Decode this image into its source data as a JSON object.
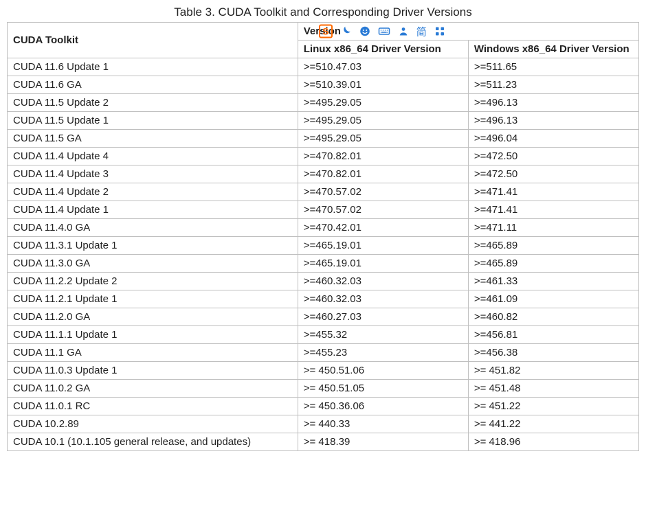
{
  "caption": "Table 3. CUDA Toolkit and Corresponding Driver Versions",
  "headers": {
    "cuda": "CUDA Toolkit",
    "tcdv_suffix": "Version",
    "linux": "Linux x86_64 Driver Version",
    "windows": "Windows x86_64 Driver Version"
  },
  "ime": {
    "logo_letter": "S",
    "simplified_label": "简"
  },
  "chart_data": {
    "type": "table",
    "title": "Table 3. CUDA Toolkit and Corresponding Driver Versions",
    "columns": [
      "CUDA Toolkit",
      "Linux x86_64 Driver Version",
      "Windows x86_64 Driver Version"
    ],
    "rows": [
      {
        "cuda": "CUDA 11.6 Update 1",
        "linux": ">=510.47.03",
        "windows": ">=511.65"
      },
      {
        "cuda": "CUDA 11.6 GA",
        "linux": ">=510.39.01",
        "windows": ">=511.23"
      },
      {
        "cuda": "CUDA 11.5 Update 2",
        "linux": ">=495.29.05",
        "windows": ">=496.13"
      },
      {
        "cuda": "CUDA 11.5 Update 1",
        "linux": ">=495.29.05",
        "windows": ">=496.13"
      },
      {
        "cuda": "CUDA 11.5 GA",
        "linux": ">=495.29.05",
        "windows": ">=496.04"
      },
      {
        "cuda": "CUDA 11.4 Update 4",
        "linux": ">=470.82.01",
        "windows": ">=472.50"
      },
      {
        "cuda": "CUDA 11.4 Update 3",
        "linux": ">=470.82.01",
        "windows": ">=472.50"
      },
      {
        "cuda": "CUDA 11.4 Update 2",
        "linux": ">=470.57.02",
        "windows": ">=471.41"
      },
      {
        "cuda": "CUDA 11.4 Update 1",
        "linux": ">=470.57.02",
        "windows": ">=471.41"
      },
      {
        "cuda": "CUDA 11.4.0 GA",
        "linux": ">=470.42.01",
        "windows": ">=471.11"
      },
      {
        "cuda": "CUDA 11.3.1 Update 1",
        "linux": ">=465.19.01",
        "windows": ">=465.89"
      },
      {
        "cuda": "CUDA 11.3.0 GA",
        "linux": ">=465.19.01",
        "windows": ">=465.89"
      },
      {
        "cuda": "CUDA 11.2.2 Update 2",
        "linux": ">=460.32.03",
        "windows": ">=461.33"
      },
      {
        "cuda": "CUDA 11.2.1 Update 1",
        "linux": ">=460.32.03",
        "windows": ">=461.09"
      },
      {
        "cuda": "CUDA 11.2.0 GA",
        "linux": ">=460.27.03",
        "windows": ">=460.82"
      },
      {
        "cuda": "CUDA 11.1.1 Update 1",
        "linux": ">=455.32",
        "windows": ">=456.81"
      },
      {
        "cuda": "CUDA 11.1 GA",
        "linux": ">=455.23",
        "windows": ">=456.38"
      },
      {
        "cuda": "CUDA 11.0.3 Update 1",
        "linux": ">= 450.51.06",
        "windows": ">= 451.82"
      },
      {
        "cuda": "CUDA 11.0.2 GA",
        "linux": ">= 450.51.05",
        "windows": ">= 451.48"
      },
      {
        "cuda": "CUDA 11.0.1 RC",
        "linux": ">= 450.36.06",
        "windows": ">= 451.22"
      },
      {
        "cuda": "CUDA 10.2.89",
        "linux": ">= 440.33",
        "windows": ">= 441.22"
      },
      {
        "cuda": "CUDA 10.1 (10.1.105 general release, and updates)",
        "linux": ">= 418.39",
        "windows": ">= 418.96"
      }
    ]
  }
}
